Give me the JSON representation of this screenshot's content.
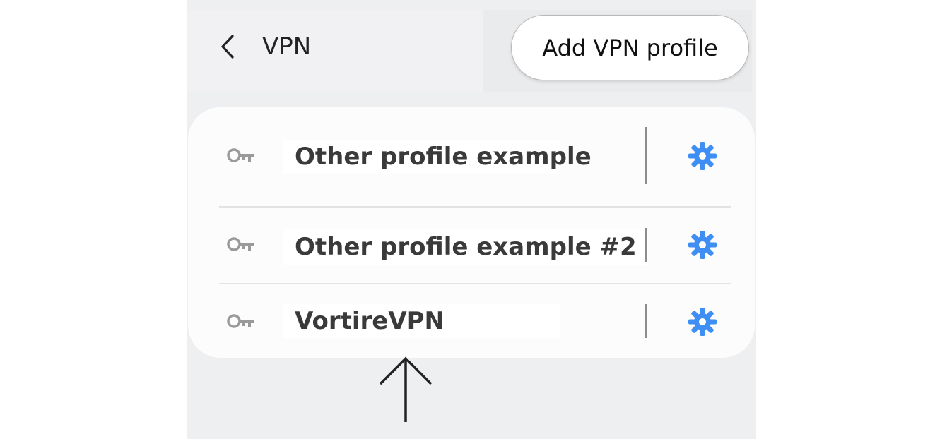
{
  "header": {
    "title": "VPN",
    "back_icon": "chevron-left-icon"
  },
  "actions": {
    "add_vpn_profile_label": "Add VPN profile"
  },
  "profiles": [
    {
      "name": "Other profile example",
      "icon": "key-icon",
      "settings_icon": "gear-icon"
    },
    {
      "name": "Other profile example #2",
      "icon": "key-icon",
      "settings_icon": "gear-icon"
    },
    {
      "name": "VortireVPN",
      "icon": "key-icon",
      "settings_icon": "gear-icon"
    }
  ],
  "annotation": {
    "icon": "up-arrow-icon"
  },
  "colors": {
    "accent_gear": "#3f8ef3",
    "key_icon": "#9a9a9a",
    "background": "#eeeff1",
    "card": "#fcfcfc"
  }
}
